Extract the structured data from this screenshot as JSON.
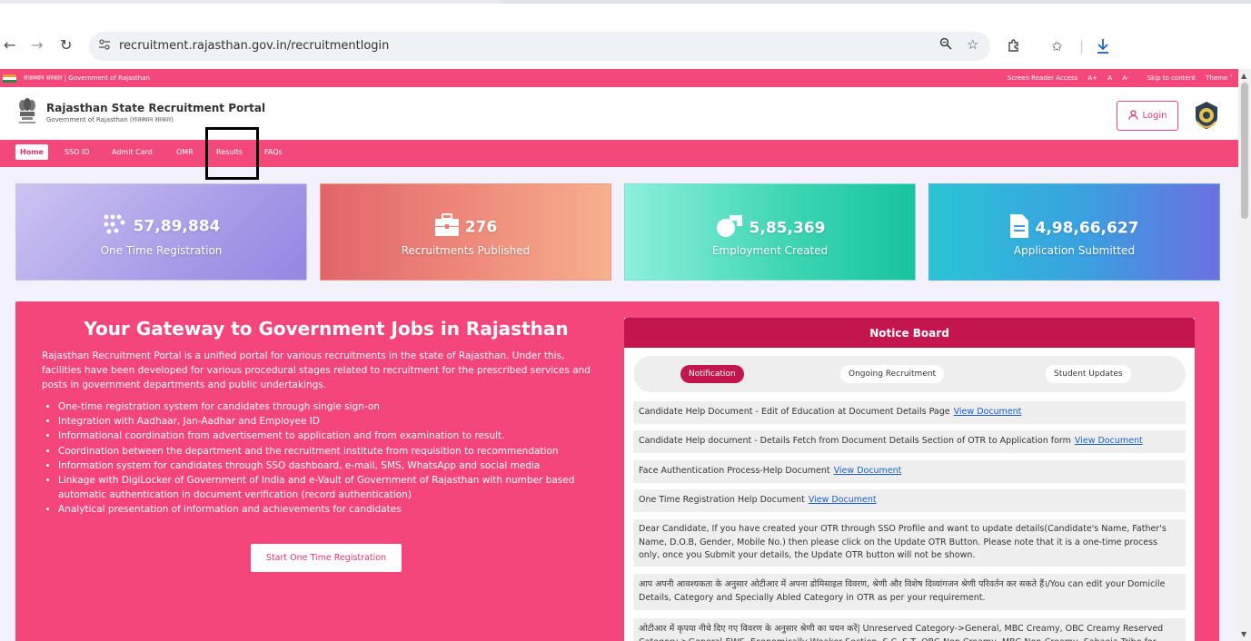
{
  "browser": {
    "url": "recruitment.rajasthan.gov.in/recruitmentlogin"
  },
  "govbar": {
    "left_text": "राजस्थान सरकार | Government of Rajasthan",
    "screen_reader": "Screen Reader Access",
    "a_plus": "A+",
    "a": "A",
    "a_minus": "A-",
    "skip": "Skip to content",
    "theme": "Theme ˅"
  },
  "header": {
    "title": "Rajasthan State Recruitment Portal",
    "subtitle": "Government of Rajasthan (राजस्थान सरकार)",
    "login_label": "Login"
  },
  "menu": {
    "home": "Home",
    "sso": "SSO ID",
    "admit": "Admit Card",
    "omr": "OMR",
    "results": "Results",
    "faqs": "FAQs"
  },
  "stats": [
    {
      "value": "57,89,884",
      "label": "One Time Registration"
    },
    {
      "value": "276",
      "label": "Recruitments Published"
    },
    {
      "value": "5,85,369",
      "label": "Employment Created"
    },
    {
      "value": "4,98,66,627",
      "label": "Application Submitted"
    }
  ],
  "gateway": {
    "title": "Your Gateway to Government Jobs in Rajasthan",
    "intro": "Rajasthan Recruitment Portal is a unified portal for various recruitments in the state of Rajasthan. Under this, facilities have been developed for various procedural stages related to recruitment for the prescribed services and posts in government departments and public undertakings.",
    "points": [
      "One-time registration system for candidates through single sign-on",
      "Integration with Aadhaar, Jan-Aadhar and Employee ID",
      "Informational coordination from advertisement to application and from examination to result.",
      "Coordination between the department and the recruitment institute from requisition to recommendation",
      "Information system for candidates through SSO dashboard, e-mail, SMS, WhatsApp and social media",
      "Linkage with DigiLocker of Government of India and e-Vault of Government of Rajasthan with number based automatic authentication in document verification (record authentication)",
      "Analytical presentation of information and achievements for candidates"
    ],
    "button": "Start One Time Registration"
  },
  "notice": {
    "title": "Notice Board",
    "tabs": [
      "Notification",
      "Ongoing Recruitment",
      "Student Updates"
    ],
    "link_text": "View Document",
    "items": [
      "Candidate Help Document - Edit of Education at Document Details Page",
      "Candidate Help document - Details Fetch from Document Details Section of OTR to Application form",
      "Face Authentication Process-Help Document",
      "One Time Registration Help Document",
      "Dear Candidate, If you have created your OTR through SSO Profile and want to update details(Candidate's Name, Father's Name, D.O.B, Gender, Mobile No.) then please click on the Update OTR Button. Please note that it is a one-time process only, once you Submit your details, the Update OTR button will not be shown.",
      "आप अपनी आवश्यकता के अनुसार ओटीआर में अपना डोमिसाइल विवरण, श्रेणी और विशेष दिव्यांगजन श्रेणी परिवर्तन कर सकते हैं।/You can edit your Domicile Details, Category and Specially Abled Category in OTR as per your requirement.",
      "ओटीआर में कृपया नीचे दिए गए विवरण के अनुसार श्रेणी का चयन करें| Unreserved Category->General, MBC Creamy, OBC Creamy Reserved Category->General-EWS, Economically Weaker Section, S.C, S.T, OBC-Non Creamy, MBC-Non-Creamy, Sahaeia Tribe for"
    ]
  },
  "colors": {
    "brand_pink": "#f2487a",
    "notice_red": "#c4164e"
  }
}
